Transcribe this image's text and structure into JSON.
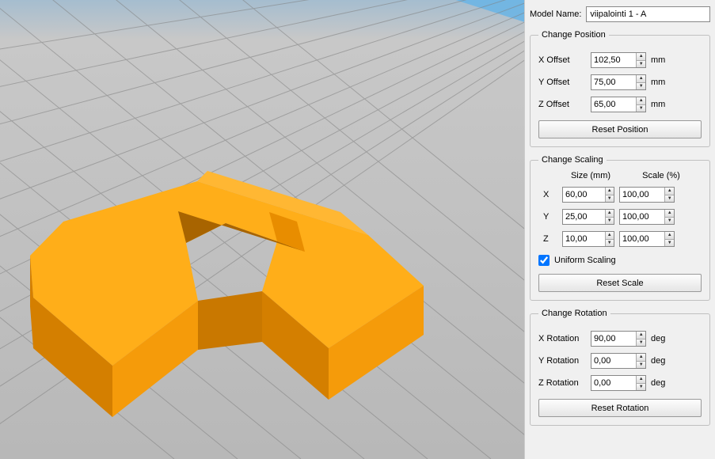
{
  "model_name_label": "Model Name:",
  "model_name": "viipalointi 1 - A",
  "position": {
    "legend": "Change Position",
    "x_label": "X Offset",
    "y_label": "Y Offset",
    "z_label": "Z Offset",
    "x": "102,50",
    "y": "75,00",
    "z": "65,00",
    "unit": "mm",
    "reset": "Reset Position"
  },
  "scaling": {
    "legend": "Change Scaling",
    "size_header": "Size (mm)",
    "scale_header": "Scale (%)",
    "x_label": "X",
    "y_label": "Y",
    "z_label": "Z",
    "x_size": "60,00",
    "y_size": "25,00",
    "z_size": "10,00",
    "x_scale": "100,00",
    "y_scale": "100,00",
    "z_scale": "100,00",
    "uniform_label": "Uniform Scaling",
    "uniform": true,
    "reset": "Reset Scale"
  },
  "rotation": {
    "legend": "Change Rotation",
    "x_label": "X Rotation",
    "y_label": "Y Rotation",
    "z_label": "Z Rotation",
    "x": "90,00",
    "y": "0,00",
    "z": "0,00",
    "unit": "deg",
    "reset": "Reset Rotation"
  }
}
